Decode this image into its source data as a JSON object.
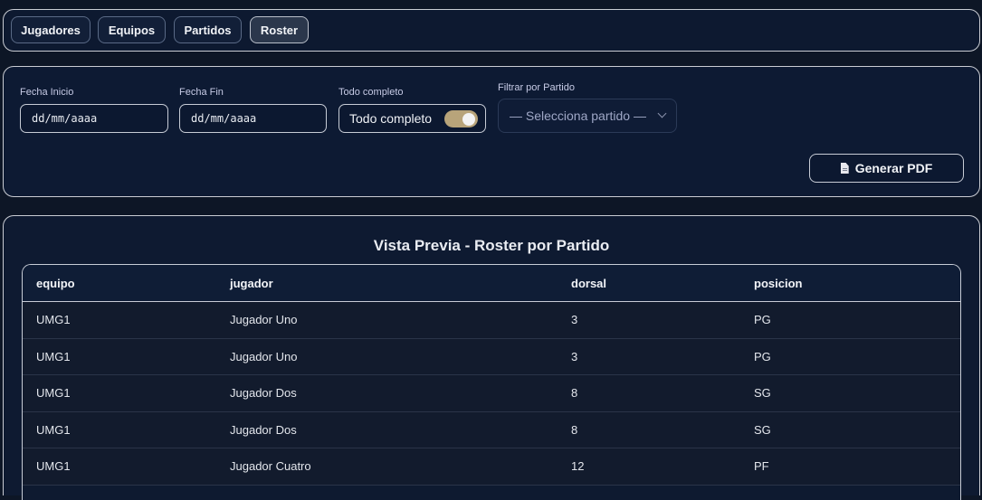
{
  "nav": {
    "tabs": [
      {
        "label": "Jugadores",
        "active": false
      },
      {
        "label": "Equipos",
        "active": false
      },
      {
        "label": "Partidos",
        "active": false
      },
      {
        "label": "Roster",
        "active": true
      }
    ]
  },
  "filters": {
    "fecha_inicio_label": "Fecha Inicio",
    "fecha_inicio_value": "dd/mm/aaaa",
    "fecha_fin_label": "Fecha Fin",
    "fecha_fin_value": "dd/mm/aaaa",
    "todo_completo_label": "Todo completo",
    "todo_completo_text": "Todo completo",
    "todo_completo_on": true,
    "partido_label": "Filtrar por Partido",
    "partido_selected": "— Selecciona partido —",
    "generate_button": "Generar PDF"
  },
  "preview": {
    "title": "Vista Previa - Roster por Partido",
    "columns": [
      "equipo",
      "jugador",
      "dorsal",
      "posicion"
    ],
    "rows": [
      [
        "UMG1",
        "Jugador Uno",
        "3",
        "PG"
      ],
      [
        "UMG1",
        "Jugador Uno",
        "3",
        "PG"
      ],
      [
        "UMG1",
        "Jugador Dos",
        "8",
        "SG"
      ],
      [
        "UMG1",
        "Jugador Dos",
        "8",
        "SG"
      ],
      [
        "UMG1",
        "Jugador Cuatro",
        "12",
        "PF"
      ]
    ]
  },
  "colors": {
    "background": "#0d1626",
    "accent_toggle": "#b8a47a"
  }
}
